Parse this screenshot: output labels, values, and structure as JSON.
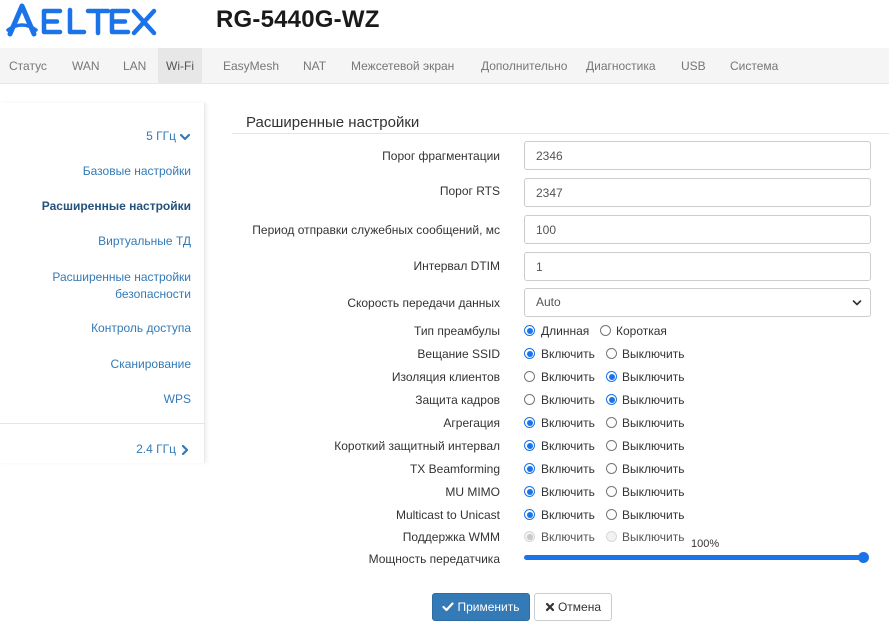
{
  "header": {
    "brand": "ELTEX",
    "model": "RG-5440G-WZ",
    "brand_color": "#1a73e8"
  },
  "nav": {
    "items": [
      {
        "label": "Статус"
      },
      {
        "label": "WAN"
      },
      {
        "label": "LAN"
      },
      {
        "label": "Wi-Fi",
        "active": true
      },
      {
        "label": "EasyMesh"
      },
      {
        "label": "NAT"
      },
      {
        "label": "Межсетевой экран"
      },
      {
        "label": "Дополнительно"
      },
      {
        "label": "Диагностика"
      },
      {
        "label": "USB"
      },
      {
        "label": "Система"
      }
    ]
  },
  "sidebar": {
    "band5": "5 ГГц",
    "items": [
      {
        "label": "Базовые настройки"
      },
      {
        "label": "Расширенные настройки",
        "active": true
      },
      {
        "label": "Виртуальные ТД"
      },
      {
        "label": "Расширенные настройки"
      },
      {
        "label": "безопасности"
      },
      {
        "label": "Контроль доступа"
      },
      {
        "label": "Сканирование"
      },
      {
        "label": "WPS"
      }
    ],
    "band24": "2.4 ГГц"
  },
  "main": {
    "title": "Расширенные настройки",
    "fields": {
      "frag": {
        "label": "Порог фрагментации",
        "value": "2346"
      },
      "rts": {
        "label": "Порог RTS",
        "value": "2347"
      },
      "beacon": {
        "label": "Период отправки служебных сообщений, мс",
        "value": "100"
      },
      "dtim": {
        "label": "Интервал DTIM",
        "value": "1"
      },
      "rate": {
        "label": "Скорость передачи данных",
        "value": "Auto"
      }
    },
    "radios": {
      "preamble": {
        "label": "Тип преамбулы",
        "opt1": "Длинная",
        "opt2": "Короткая",
        "selected": 1
      },
      "ssid": {
        "label": "Вещание SSID",
        "opt1": "Включить",
        "opt2": "Выключить",
        "selected": 1
      },
      "isolation": {
        "label": "Изоляция клиентов",
        "opt1": "Включить",
        "opt2": "Выключить",
        "selected": 2
      },
      "frame": {
        "label": "Защита кадров",
        "opt1": "Включить",
        "opt2": "Выключить",
        "selected": 2
      },
      "aggr": {
        "label": "Агрегация",
        "opt1": "Включить",
        "opt2": "Выключить",
        "selected": 1
      },
      "sgi": {
        "label": "Короткий защитный интервал",
        "opt1": "Включить",
        "opt2": "Выключить",
        "selected": 1
      },
      "txbf": {
        "label": "TX Beamforming",
        "opt1": "Включить",
        "opt2": "Выключить",
        "selected": 1
      },
      "mumimo": {
        "label": "MU MIMO",
        "opt1": "Включить",
        "opt2": "Выключить",
        "selected": 1
      },
      "mc2uc": {
        "label": "Multicast to Unicast",
        "opt1": "Включить",
        "opt2": "Выключить",
        "selected": 1
      },
      "wmm": {
        "label": "Поддержка WMM",
        "opt1": "Включить",
        "opt2": "Выключить",
        "selected": 1,
        "disabled": true
      }
    },
    "power": {
      "label": "Мощность передатчика",
      "value": "100%",
      "level": 1.0
    },
    "apply": "Применить",
    "cancel": "Отмена"
  }
}
